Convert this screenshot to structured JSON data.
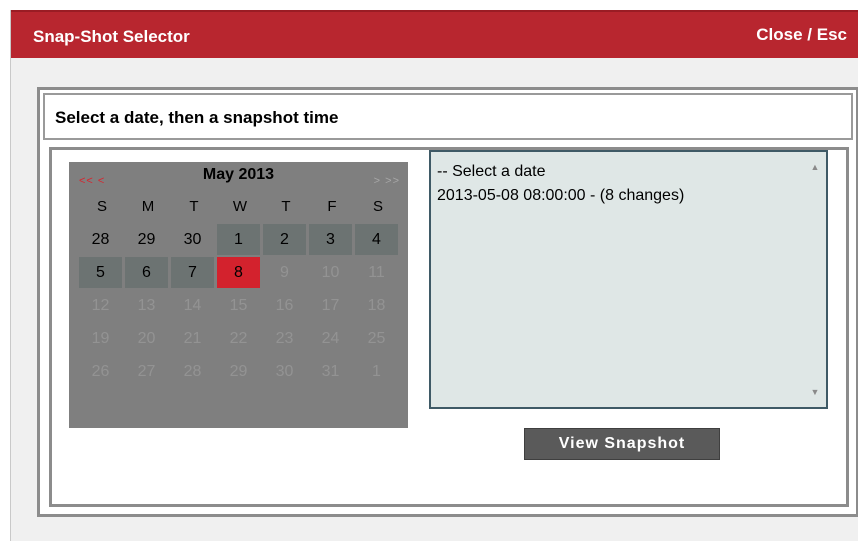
{
  "window": {
    "title": "Snap-Shot Selector",
    "close_label": "Close / Esc"
  },
  "instructions": "Select a date, then a snapshot time",
  "calendar": {
    "month_label": "May 2013",
    "prev_label": "<< <",
    "next_label": "> >>",
    "weekdays": [
      "S",
      "M",
      "T",
      "W",
      "T",
      "F",
      "S"
    ],
    "days": [
      {
        "label": "28",
        "state": "prev"
      },
      {
        "label": "29",
        "state": "prev"
      },
      {
        "label": "30",
        "state": "prev"
      },
      {
        "label": "1",
        "state": "avail"
      },
      {
        "label": "2",
        "state": "avail"
      },
      {
        "label": "3",
        "state": "avail"
      },
      {
        "label": "4",
        "state": "avail"
      },
      {
        "label": "5",
        "state": "avail"
      },
      {
        "label": "6",
        "state": "avail"
      },
      {
        "label": "7",
        "state": "avail"
      },
      {
        "label": "8",
        "state": "sel"
      },
      {
        "label": "9",
        "state": "dim"
      },
      {
        "label": "10",
        "state": "dim"
      },
      {
        "label": "11",
        "state": "dim"
      },
      {
        "label": "12",
        "state": "dim"
      },
      {
        "label": "13",
        "state": "dim"
      },
      {
        "label": "14",
        "state": "dim"
      },
      {
        "label": "15",
        "state": "dim"
      },
      {
        "label": "16",
        "state": "dim"
      },
      {
        "label": "17",
        "state": "dim"
      },
      {
        "label": "18",
        "state": "dim"
      },
      {
        "label": "19",
        "state": "dim"
      },
      {
        "label": "20",
        "state": "dim"
      },
      {
        "label": "21",
        "state": "dim"
      },
      {
        "label": "22",
        "state": "dim"
      },
      {
        "label": "23",
        "state": "dim"
      },
      {
        "label": "24",
        "state": "dim"
      },
      {
        "label": "25",
        "state": "dim"
      },
      {
        "label": "26",
        "state": "dim"
      },
      {
        "label": "27",
        "state": "dim"
      },
      {
        "label": "28",
        "state": "dim"
      },
      {
        "label": "29",
        "state": "dim"
      },
      {
        "label": "30",
        "state": "dim"
      },
      {
        "label": "31",
        "state": "dim"
      },
      {
        "label": "1",
        "state": "dim"
      }
    ]
  },
  "snapshot_list": {
    "items": [
      "-- Select a date",
      "2013-05-08 08:00:00 - (8 changes)"
    ],
    "scroll_up_icon": "triangle-up-icon",
    "scroll_down_icon": "triangle-down-icon"
  },
  "view_button_label": "View Snapshot",
  "colors": {
    "titlebar": "#b8262f",
    "selected_day": "#d3222d",
    "calendar_bg": "#7f7f7f",
    "list_bg": "#dfe7e6",
    "button_bg": "#5a5a5a"
  }
}
